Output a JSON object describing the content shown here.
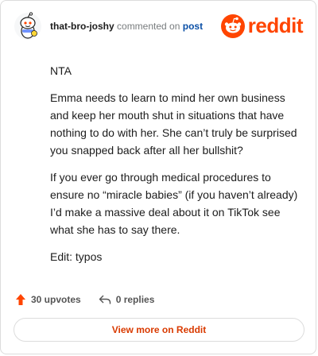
{
  "header": {
    "username": "that-bro-joshy",
    "action_text": "commented on",
    "post_link": "post",
    "brand_name": "reddit",
    "brand_color": "#ff4500"
  },
  "comment": {
    "paragraphs": [
      "NTA",
      "Emma needs to learn to mind her own business and keep her mouth shut in situations that have nothing to do with her. She can’t truly be surprised you snapped back after all her bullshit?",
      "If you ever go through medical procedures to ensure no “miracle babies” (if you haven’t already) I’d make a massive deal about it on TikTok see what she has to say there.",
      "Edit: typos"
    ]
  },
  "actions": {
    "upvotes_label": "30 upvotes",
    "replies_label": "0 replies"
  },
  "footer": {
    "view_more_label": "View more on Reddit"
  },
  "icons": {
    "avatar": "snoo-avatar-icon",
    "logo": "reddit-snoo-icon",
    "upvote": "upvote-arrow-icon",
    "reply": "reply-arrow-icon"
  }
}
